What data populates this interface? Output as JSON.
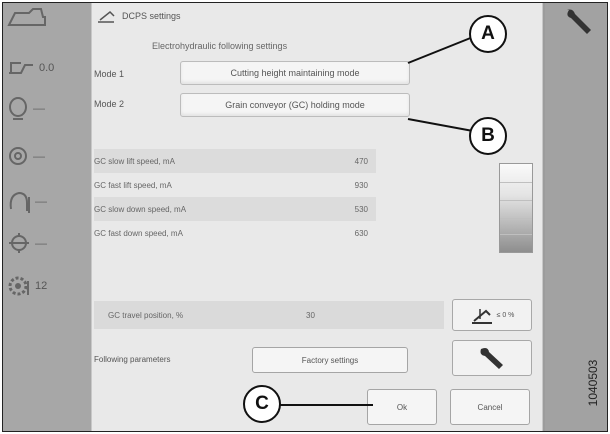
{
  "dialog": {
    "title": "DCPS settings",
    "subtitle": "Electrohydraulic following settings",
    "modes": [
      {
        "label": "Mode 1",
        "value": "Cutting height maintaining mode"
      },
      {
        "label": "Mode 2",
        "value": "Grain conveyor (GC) holding mode"
      }
    ],
    "params": [
      {
        "name": "GC slow lift speed, mA",
        "value": "470"
      },
      {
        "name": "GC fast lift speed, mA",
        "value": "930"
      },
      {
        "name": "GC slow down speed, mA",
        "value": "530"
      },
      {
        "name": "GC fast down speed, mA",
        "value": "630"
      }
    ],
    "travel": {
      "label": "GC travel position, %",
      "value": "30"
    },
    "travel_button_text": "≤ 0 %",
    "following_label": "Following parameters",
    "factory_button": "Factory settings",
    "ok_button": "Ok",
    "cancel_button": "Cancel"
  },
  "rail": {
    "top_value": "0.0",
    "dashes": [
      "—",
      "—",
      "—",
      "—"
    ],
    "bottom_value": "12"
  },
  "callouts": {
    "a": "A",
    "b": "B",
    "c": "C"
  },
  "figure_number": "1040503"
}
